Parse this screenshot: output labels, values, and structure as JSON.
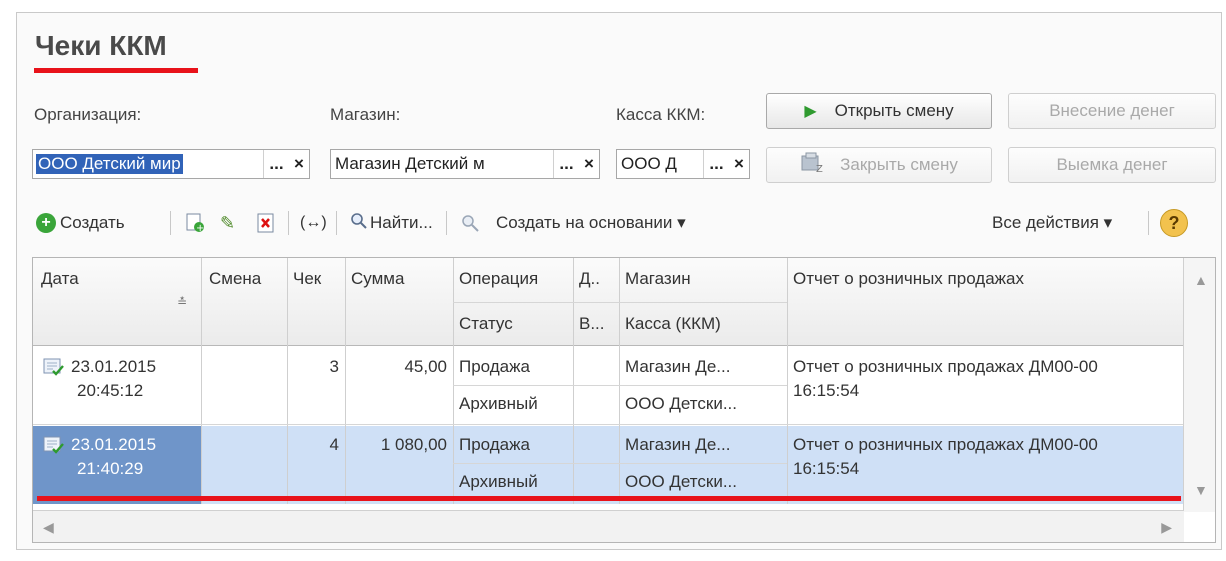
{
  "title": "Чеки ККМ",
  "filters": {
    "org_label": "Организация:",
    "org_value": "ООО Детский мир",
    "shop_label": "Магазин:",
    "shop_value": "Магазин Детский м",
    "kassa_label": "Касса ККМ:",
    "kassa_value": "ООО Д",
    "ellipsis": "...",
    "clear": "×"
  },
  "buttons": {
    "open_shift": "Открыть смену",
    "close_shift": "Закрыть смену",
    "deposit": "Внесение денег",
    "withdraw": "Выемка денег"
  },
  "toolbar": {
    "create": "Создать",
    "find": "Найти...",
    "create_based": "Создать на основании ▾",
    "all_actions": "Все действия ▾",
    "help": "?"
  },
  "table": {
    "headers": {
      "date": "Дата",
      "shift": "Смена",
      "check": "Чек",
      "sum": "Сумма",
      "operation": "Операция",
      "status": "Статус",
      "d": "Д..",
      "v": "В...",
      "shop": "Магазин",
      "kassa": "Касса (ККМ)",
      "report": "Отчет о розничных продажах"
    },
    "rows": [
      {
        "date": "23.01.2015",
        "time": "20:45:12",
        "shift": "",
        "check": "3",
        "sum": "45,00",
        "operation": "Продажа",
        "status": "Архивный",
        "shop": "Магазин Де...",
        "kassa": "ООО Детски...",
        "report": "Отчет о розничных продажах ДМ00-00",
        "report_time": "16:15:54"
      },
      {
        "date": "23.01.2015",
        "time": "21:40:29",
        "shift": "",
        "check": "4",
        "sum": "1 080,00",
        "operation": "Продажа",
        "status": "Архивный",
        "shop": "Магазин Де...",
        "kassa": "ООО Детски...",
        "report": "Отчет о розничных продажах ДМ00-00",
        "report_time": "16:15:54"
      }
    ]
  },
  "colors": {
    "accent_red": "#e8121a",
    "selection": "#cfe0f6",
    "selection_dark": "#6f95c9"
  }
}
